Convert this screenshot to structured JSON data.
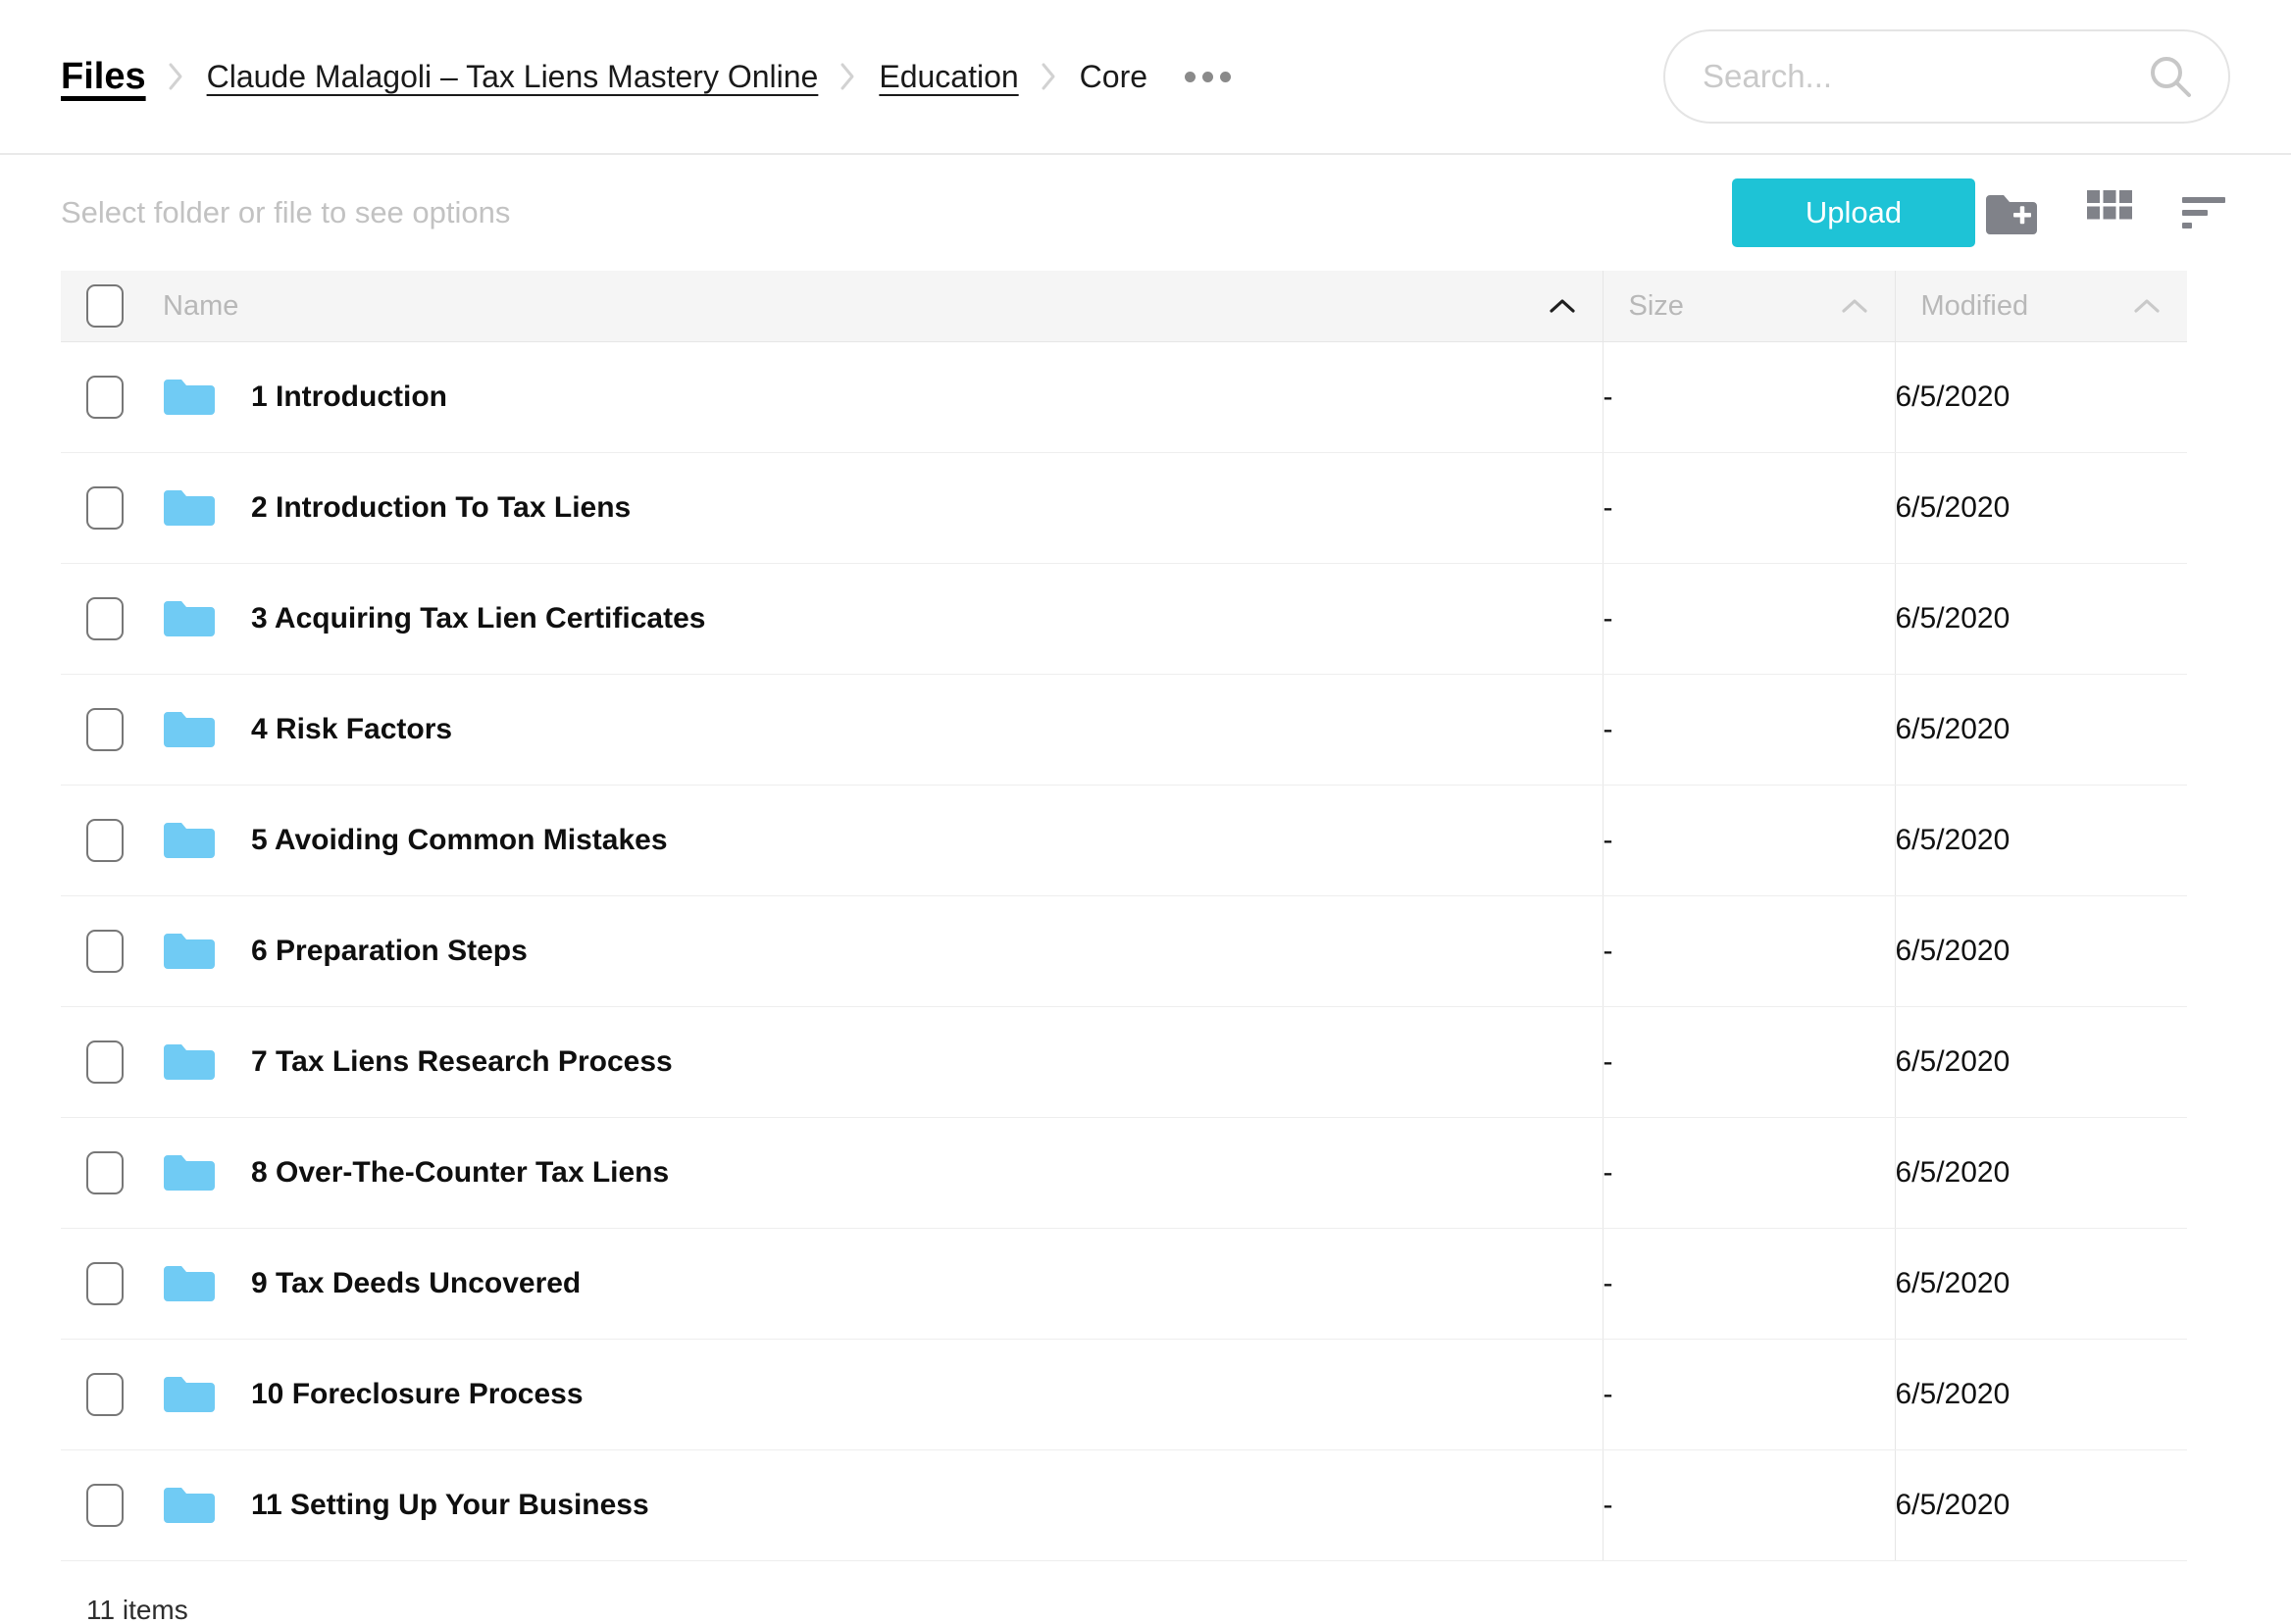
{
  "header": {
    "root_label": "Files",
    "breadcrumb": [
      {
        "label": "Claude Malagoli – Tax Liens Mastery Online",
        "type": "link"
      },
      {
        "label": "Education",
        "type": "link"
      },
      {
        "label": "Core",
        "type": "plain"
      }
    ],
    "overflow_icon": "ellipsis-icon"
  },
  "search": {
    "placeholder": "Search...",
    "value": "",
    "icon": "search-icon"
  },
  "toolbar": {
    "hint": "Select folder or file to see options",
    "upload_label": "Upload",
    "upload_color": "#1ec3d6",
    "icons": [
      {
        "name": "new-folder-icon",
        "label": "New folder"
      },
      {
        "name": "grid-view-icon",
        "label": "Grid view"
      },
      {
        "name": "sort-icon",
        "label": "Sort"
      }
    ]
  },
  "table": {
    "columns": [
      {
        "key": "name",
        "label": "Name",
        "sort": "asc-active"
      },
      {
        "key": "size",
        "label": "Size",
        "sort": "asc-idle"
      },
      {
        "key": "modified",
        "label": "Modified",
        "sort": "asc-idle"
      }
    ],
    "rows": [
      {
        "name": "1 Introduction",
        "icon": "folder-icon",
        "size": "-",
        "modified": "6/5/2020"
      },
      {
        "name": "2 Introduction To Tax Liens",
        "icon": "folder-icon",
        "size": "-",
        "modified": "6/5/2020"
      },
      {
        "name": "3 Acquiring Tax Lien Certificates",
        "icon": "folder-icon",
        "size": "-",
        "modified": "6/5/2020"
      },
      {
        "name": "4 Risk Factors",
        "icon": "folder-icon",
        "size": "-",
        "modified": "6/5/2020"
      },
      {
        "name": "5 Avoiding Common Mistakes",
        "icon": "folder-icon",
        "size": "-",
        "modified": "6/5/2020"
      },
      {
        "name": "6 Preparation Steps",
        "icon": "folder-icon",
        "size": "-",
        "modified": "6/5/2020"
      },
      {
        "name": "7 Tax Liens Research Process",
        "icon": "folder-icon",
        "size": "-",
        "modified": "6/5/2020"
      },
      {
        "name": "8 Over-The-Counter Tax Liens",
        "icon": "folder-icon",
        "size": "-",
        "modified": "6/5/2020"
      },
      {
        "name": "9 Tax Deeds Uncovered",
        "icon": "folder-icon",
        "size": "-",
        "modified": "6/5/2020"
      },
      {
        "name": "10 Foreclosure Process",
        "icon": "folder-icon",
        "size": "-",
        "modified": "6/5/2020"
      },
      {
        "name": "11 Setting Up Your Business",
        "icon": "folder-icon",
        "size": "-",
        "modified": "6/5/2020"
      }
    ]
  },
  "footer": {
    "item_count": "11 items"
  },
  "colors": {
    "accent": "#1ec3d6",
    "folder": "#70cbf4",
    "header_bg": "#f5f5f5",
    "muted_text": "#c2c2c2"
  }
}
